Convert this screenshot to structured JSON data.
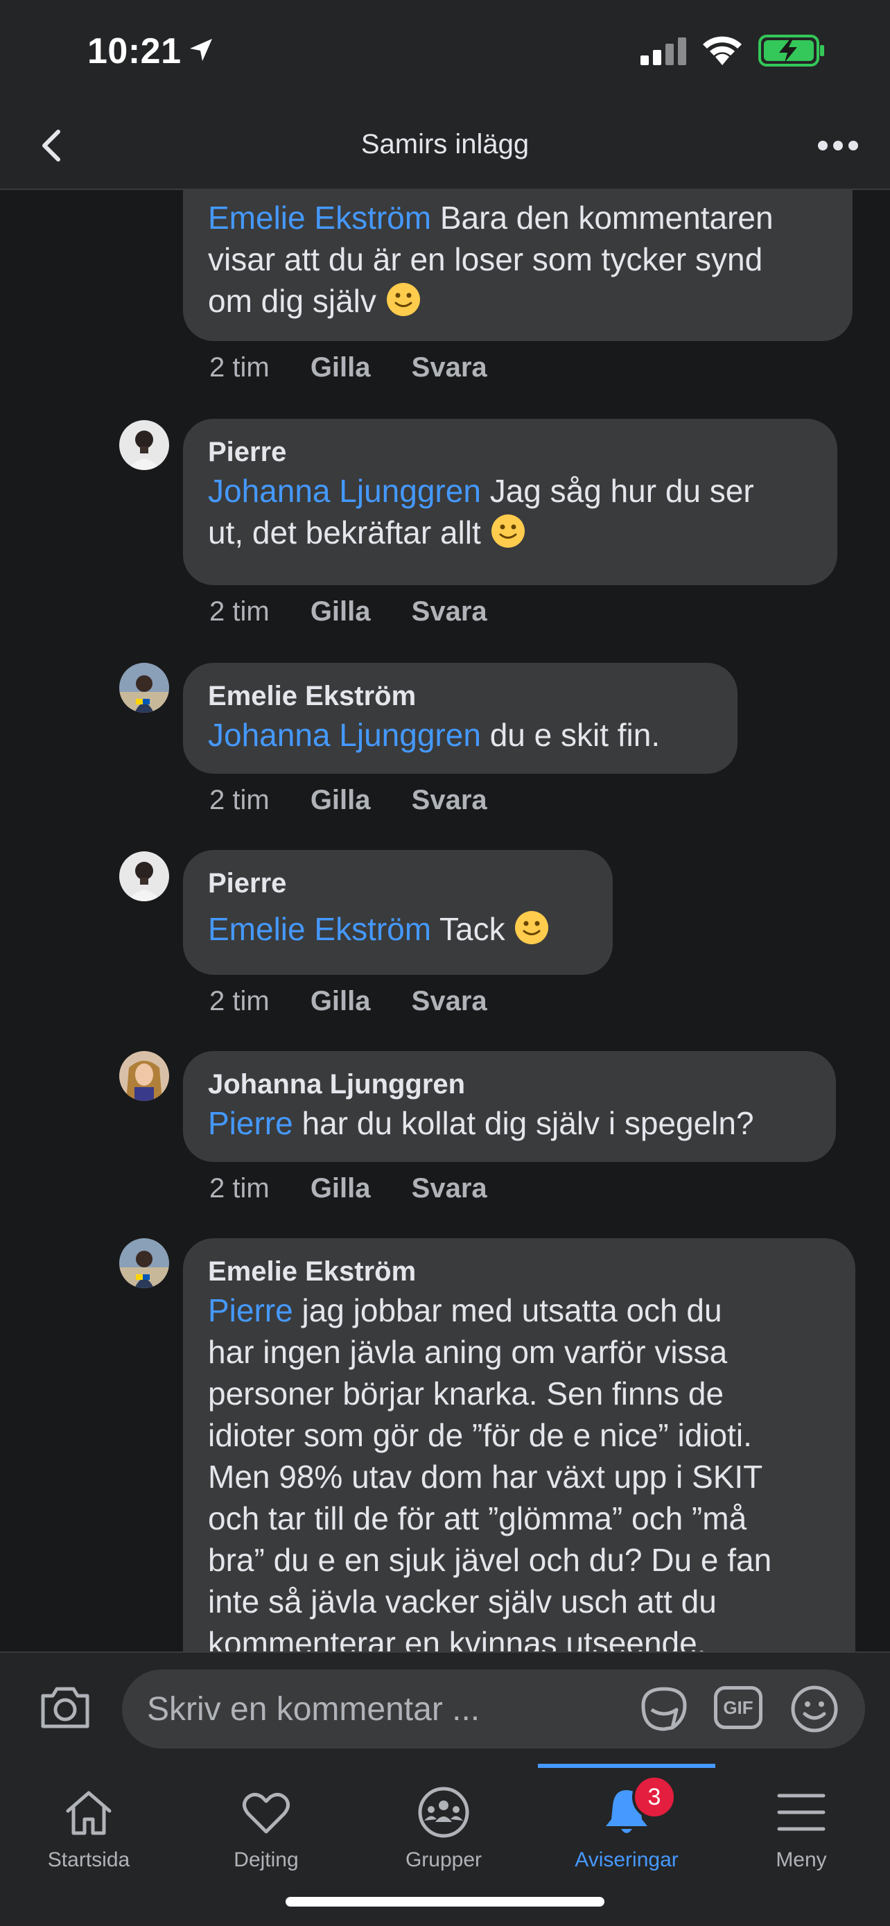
{
  "status_bar": {
    "time": "10:21"
  },
  "header": {
    "title": "Samirs inlägg"
  },
  "comments": [
    {
      "author": "",
      "mention": "Emelie Ekström",
      "lines": [
        "Bara den kommentaren",
        "visar att du är en loser som tycker synd",
        "om dig själv"
      ],
      "time": "2 tim",
      "like": "Gilla",
      "reply": "Svara"
    },
    {
      "author": "Pierre",
      "mention": "Johanna Ljunggren",
      "lines": [
        "Jag såg hur du ser",
        "ut, det bekräftar allt"
      ],
      "time": "2 tim",
      "like": "Gilla",
      "reply": "Svara"
    },
    {
      "author": "Emelie Ekström",
      "mention": "Johanna Ljunggren",
      "lines": [
        "du e skit fin."
      ],
      "time": "2 tim",
      "like": "Gilla",
      "reply": "Svara"
    },
    {
      "author": "Pierre",
      "mention": "Emelie Ekström",
      "lines": [
        "Tack"
      ],
      "time": "2 tim",
      "like": "Gilla",
      "reply": "Svara"
    },
    {
      "author": "Johanna Ljunggren",
      "mention": "Pierre",
      "lines": [
        "har du kollat dig själv i spegeln?"
      ],
      "time": "2 tim",
      "like": "Gilla",
      "reply": "Svara"
    },
    {
      "author": "Emelie Ekström",
      "mention": "Pierre",
      "lines": [
        "jag jobbar med utsatta och du",
        "har ingen jävla aning om varför vissa",
        "personer börjar knarka. Sen finns de",
        "idioter som gör de ”för de e nice” idioti.",
        "Men 98% utav dom har växt upp i SKIT",
        "och tar till de för att ”glömma” och ”må",
        "bra” du e en sjuk jävel och du? Du e fan",
        "inte så jävla vacker själv usch att du",
        "kommenterar en kvinnas utseende."
      ]
    }
  ],
  "composer": {
    "placeholder": "Skriv en kommentar ...",
    "gif_label": "GIF"
  },
  "tabs": [
    {
      "label": "Startsida",
      "icon": "home-icon"
    },
    {
      "label": "Dejting",
      "icon": "heart-icon"
    },
    {
      "label": "Grupper",
      "icon": "groups-icon"
    },
    {
      "label": "Aviseringar",
      "icon": "bell-icon",
      "badge": "3",
      "active": true
    },
    {
      "label": "Meny",
      "icon": "menu-icon"
    }
  ],
  "colors": {
    "accent": "#4599ff",
    "bubble": "#3a3b3c",
    "background": "#18191a",
    "badge": "#e41e3f"
  }
}
